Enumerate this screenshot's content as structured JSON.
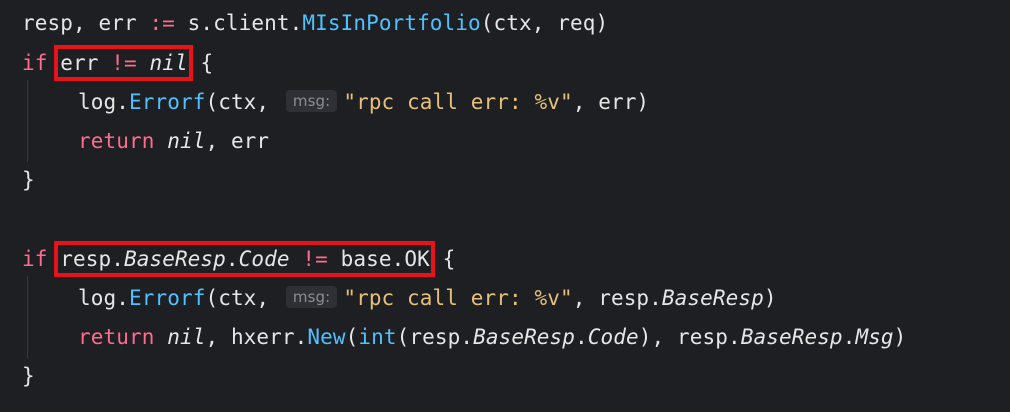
{
  "code": {
    "line1": {
      "vars": "resp, err ",
      "assign_op": ":=",
      "receiver": " s.client.",
      "method": "MIsInPortfolio",
      "args": "(ctx, req)"
    },
    "line2": {
      "kw_if": "if",
      "cond_var": "err ",
      "cond_op": "!=",
      "cond_nil": "nil",
      "brace": " {"
    },
    "line3": {
      "pkg": "log.",
      "fn": "Errorf",
      "args_start": "(ctx,",
      "hint": "msg:",
      "str": "\"rpc call err: %v\"",
      "args_end": ", err)"
    },
    "line4": {
      "kw_return": "return",
      "nil": "nil",
      "rest": ", err"
    },
    "line5": {
      "brace": "}"
    },
    "line6": {
      "kw_if": "if",
      "resp": "resp.",
      "base_resp": "BaseResp",
      "dot": ".",
      "code": "Code",
      "op": "!=",
      "rhs": "base.OK",
      "brace": " {"
    },
    "line7": {
      "pkg": "log.",
      "fn": "Errorf",
      "args_start": "(ctx,",
      "hint": "msg:",
      "str": "\"rpc call err: %v\"",
      "args_mid": ", resp.",
      "base_resp": "BaseResp",
      "close": ")"
    },
    "line8": {
      "kw_return": "return",
      "nil": "nil",
      "sep": ", hxerr.",
      "new_fn": "New",
      "open": "(",
      "int_fn": "int",
      "inner_open": "(resp.",
      "base_resp": "BaseResp",
      "dot": ".",
      "code": "Code",
      "inner_close": "), resp.",
      "base_resp2": "BaseResp",
      "dot2": ".",
      "msg": "Msg",
      "close": ")"
    },
    "line9": {
      "brace": "}"
    }
  },
  "colors": {
    "background": "#1e1f22",
    "keyword": "#ff6b8f",
    "function": "#4fc1ff",
    "string": "#e5c07b",
    "plain": "#e6e6e6",
    "highlight_box": "#e8121b"
  }
}
